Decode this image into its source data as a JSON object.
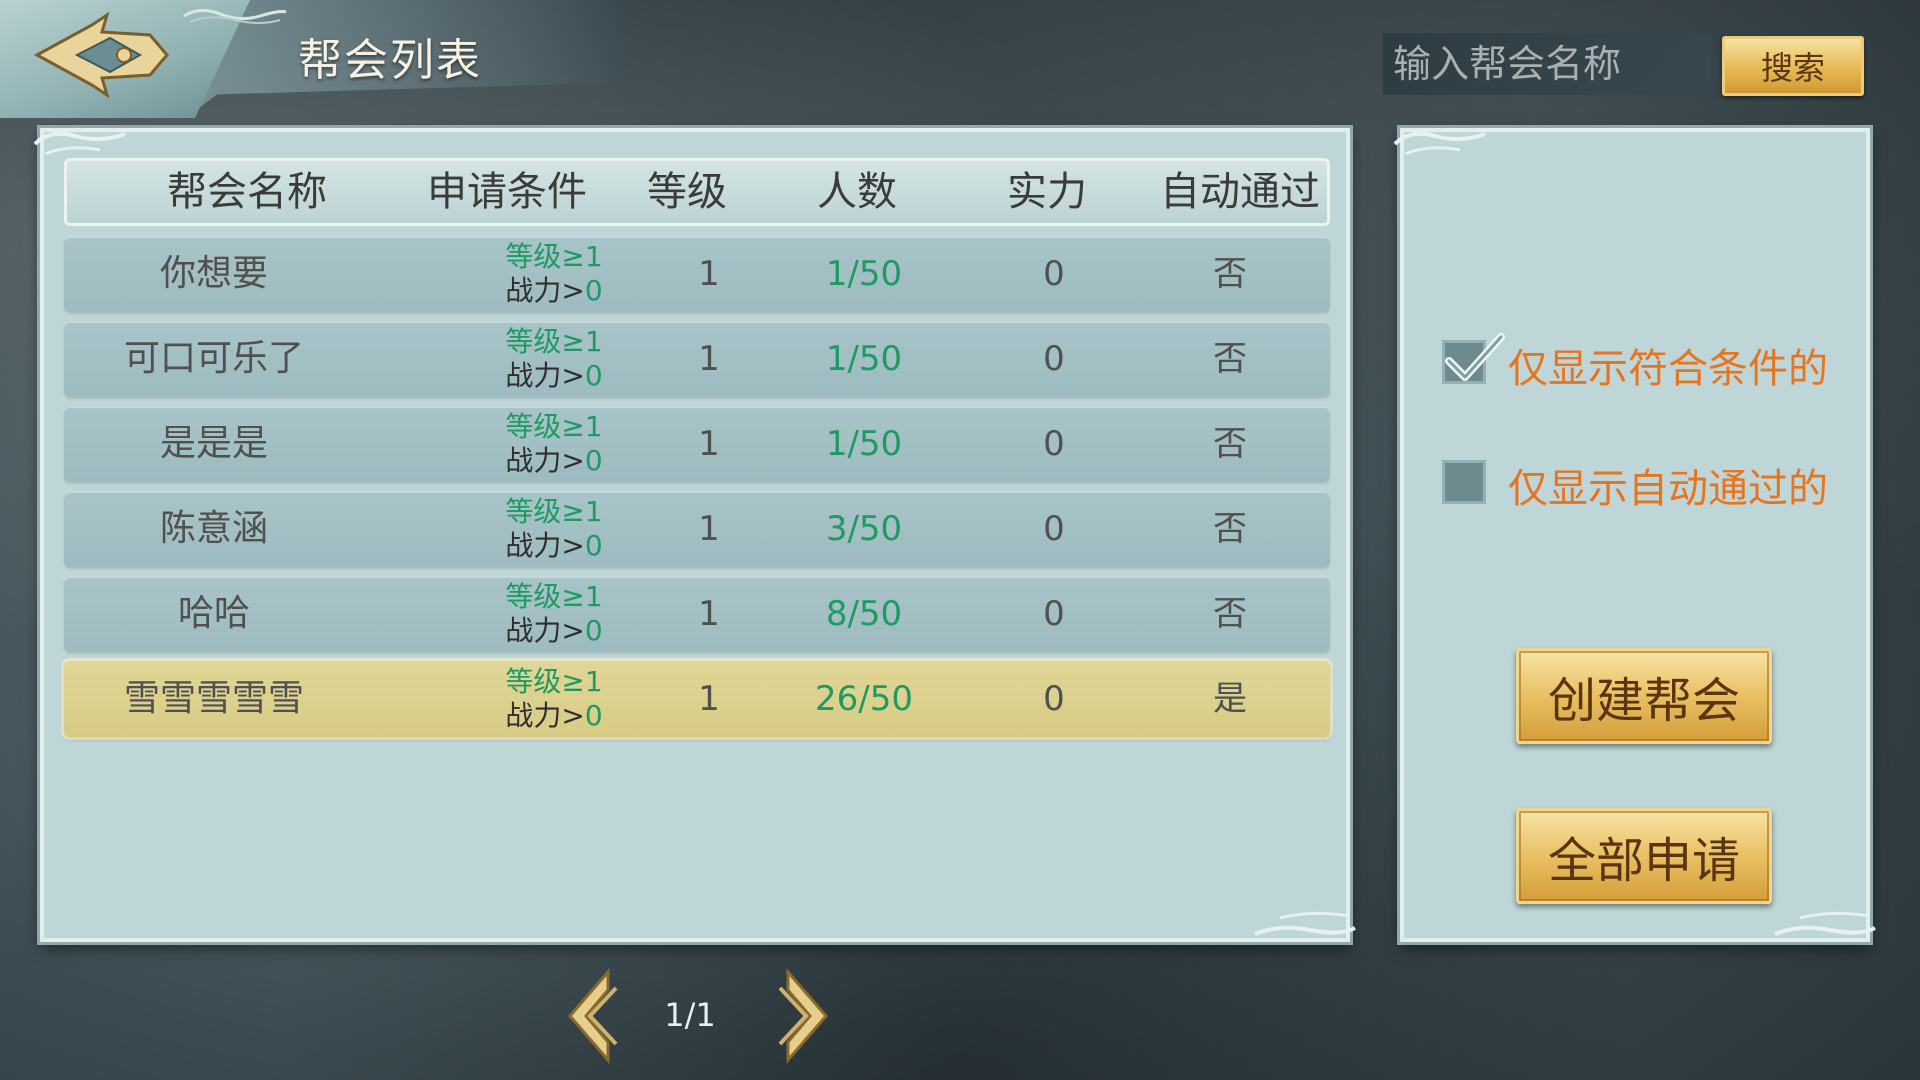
{
  "header": {
    "title": "帮会列表"
  },
  "search": {
    "placeholder": "输入帮会名称",
    "button_label": "搜索"
  },
  "table": {
    "columns": [
      "帮会名称",
      "申请条件",
      "等级",
      "人数",
      "实力",
      "自动通过"
    ],
    "rows": [
      {
        "name": "你想要",
        "cond_level": "等级≥1",
        "cond_power_label": "战力>",
        "cond_power_value": "0",
        "level": "1",
        "members": "1/50",
        "strength": "0",
        "auto": "否",
        "selected": false
      },
      {
        "name": "可口可乐了",
        "cond_level": "等级≥1",
        "cond_power_label": "战力>",
        "cond_power_value": "0",
        "level": "1",
        "members": "1/50",
        "strength": "0",
        "auto": "否",
        "selected": false
      },
      {
        "name": "是是是",
        "cond_level": "等级≥1",
        "cond_power_label": "战力>",
        "cond_power_value": "0",
        "level": "1",
        "members": "1/50",
        "strength": "0",
        "auto": "否",
        "selected": false
      },
      {
        "name": "陈意涵",
        "cond_level": "等级≥1",
        "cond_power_label": "战力>",
        "cond_power_value": "0",
        "level": "1",
        "members": "3/50",
        "strength": "0",
        "auto": "否",
        "selected": false
      },
      {
        "name": "哈哈",
        "cond_level": "等级≥1",
        "cond_power_label": "战力>",
        "cond_power_value": "0",
        "level": "1",
        "members": "8/50",
        "strength": "0",
        "auto": "否",
        "selected": false
      },
      {
        "name": "雪雪雪雪雪",
        "cond_level": "等级≥1",
        "cond_power_label": "战力>",
        "cond_power_value": "0",
        "level": "1",
        "members": "26/50",
        "strength": "0",
        "auto": "是",
        "selected": true
      }
    ]
  },
  "filters": {
    "qualified_only": {
      "label": "仅显示符合条件的",
      "checked": true
    },
    "auto_only": {
      "label": "仅显示自动通过的",
      "checked": false
    }
  },
  "actions": {
    "create_label": "创建帮会",
    "apply_all_label": "全部申请"
  },
  "pagination": {
    "text": "1/1"
  },
  "colors": {
    "accent_orange": "#e6751f",
    "member_green": "#1f9a63",
    "selected_row": "#dcd08c",
    "panel_bg": "#bfd6d8"
  }
}
